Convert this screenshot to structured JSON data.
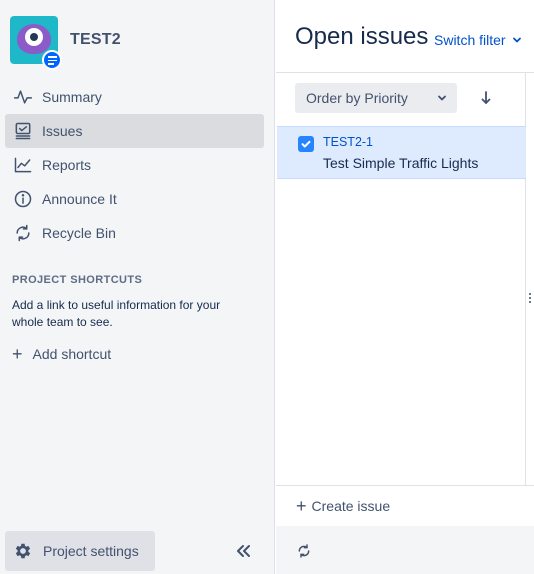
{
  "project": {
    "name": "TEST2"
  },
  "nav": {
    "items": [
      {
        "label": "Summary",
        "icon": "activity-icon"
      },
      {
        "label": "Issues",
        "icon": "issues-icon",
        "active": true
      },
      {
        "label": "Reports",
        "icon": "chart-line-icon"
      },
      {
        "label": "Announce It",
        "icon": "info-icon"
      },
      {
        "label": "Recycle Bin",
        "icon": "refresh-icon"
      }
    ]
  },
  "shortcuts": {
    "title": "PROJECT SHORTCUTS",
    "description": "Add a link to useful information for your whole team to see.",
    "add_label": "Add shortcut"
  },
  "footer": {
    "settings_label": "Project settings"
  },
  "panel": {
    "title": "Open issues",
    "switch_filter": "Switch filter",
    "order_by": "Order by Priority",
    "issues": [
      {
        "key": "TEST2-1",
        "summary": "Test Simple Traffic Lights",
        "type": "task",
        "selected": true
      }
    ],
    "create_issue": "Create issue"
  },
  "colors": {
    "accent": "#0052cc",
    "selected_bg": "#deebff",
    "sidebar_bg": "#f4f5f7",
    "task_icon": "#2684ff"
  }
}
